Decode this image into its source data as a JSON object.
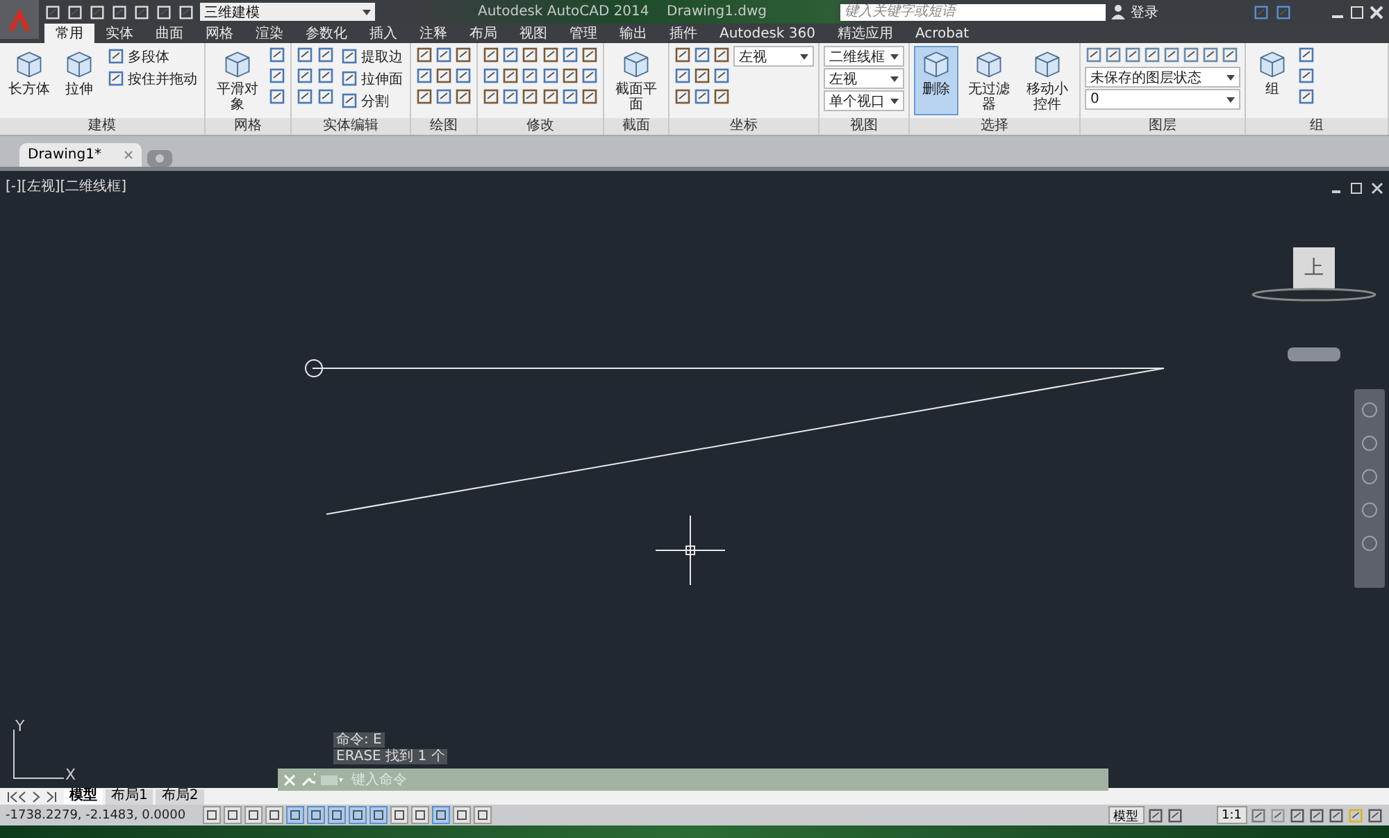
{
  "title_bar": {
    "workspace": "三维建模",
    "app_title": "Autodesk AutoCAD 2014",
    "file_name": "Drawing1.dwg",
    "search_placeholder": "键入关键字或短语",
    "login": "登录"
  },
  "ribbon_tabs": [
    {
      "label": "常用",
      "selected": true
    },
    {
      "label": "实体",
      "selected": false
    },
    {
      "label": "曲面",
      "selected": false
    },
    {
      "label": "网格",
      "selected": false
    },
    {
      "label": "渲染",
      "selected": false
    },
    {
      "label": "参数化",
      "selected": false
    },
    {
      "label": "插入",
      "selected": false
    },
    {
      "label": "注释",
      "selected": false
    },
    {
      "label": "布局",
      "selected": false
    },
    {
      "label": "视图",
      "selected": false
    },
    {
      "label": "管理",
      "selected": false
    },
    {
      "label": "输出",
      "selected": false
    },
    {
      "label": "插件",
      "selected": false
    },
    {
      "label": "Autodesk 360",
      "selected": false
    },
    {
      "label": "精选应用",
      "selected": false
    },
    {
      "label": "Acrobat",
      "selected": false
    }
  ],
  "ribbon_panels": [
    {
      "title": "建模",
      "items": [
        {
          "kind": "large",
          "label": "长方体",
          "selected": false
        },
        {
          "kind": "large",
          "label": "拉伸",
          "selected": false
        },
        {
          "kind": "stack",
          "labels": [
            "多段体",
            "按住并拖动"
          ]
        }
      ]
    },
    {
      "title": "网格",
      "items": [
        {
          "kind": "large",
          "label": "平滑对象",
          "selected": false
        },
        {
          "kind": "icon-column"
        }
      ]
    },
    {
      "title": "实体编辑",
      "items": [
        {
          "kind": "icon-column"
        },
        {
          "kind": "icon-column"
        },
        {
          "kind": "stack",
          "labels": [
            "提取边",
            "拉伸面",
            "分割"
          ]
        }
      ]
    },
    {
      "title": "绘图",
      "items": [
        {
          "kind": "icon-grid"
        }
      ]
    },
    {
      "title": "修改",
      "items": [
        {
          "kind": "icon-grid"
        },
        {
          "kind": "icon-grid"
        }
      ]
    },
    {
      "title": "截面",
      "items": [
        {
          "kind": "large",
          "label": "截面平面",
          "selected": false
        }
      ]
    },
    {
      "title": "坐标",
      "items": [
        {
          "kind": "icon-grid"
        },
        {
          "kind": "dropdowns",
          "values": [
            "左视"
          ]
        }
      ]
    },
    {
      "title": "视图",
      "items": [
        {
          "kind": "dropdowns",
          "values": [
            "二维线框",
            "左视",
            "单个视口"
          ]
        }
      ]
    },
    {
      "title": "选择",
      "items": [
        {
          "kind": "large",
          "label": "删除",
          "selected": true
        },
        {
          "kind": "large",
          "label": "无过滤器",
          "selected": false
        },
        {
          "kind": "large",
          "label": "移动小控件",
          "selected": false
        }
      ]
    },
    {
      "title": "图层",
      "items": [
        {
          "kind": "icon-row"
        },
        {
          "kind": "dropdowns",
          "values": [
            "未保存的图层状态",
            "0"
          ]
        }
      ]
    },
    {
      "title": "组",
      "items": [
        {
          "kind": "large",
          "label": "组",
          "selected": false
        },
        {
          "kind": "icon-column"
        }
      ]
    }
  ],
  "doc_tabs": [
    {
      "label": "Drawing1*",
      "selected": true
    }
  ],
  "viewport": {
    "label": "[-][左视][二维线框]",
    "viewcube_face": "上",
    "ucs_axes": [
      "Y",
      "X"
    ],
    "command_history": [
      "命令: E",
      "ERASE 找到 1 个"
    ],
    "command_placeholder": "键入命令"
  },
  "layout_tabs": [
    {
      "label": "模型",
      "selected": true
    },
    {
      "label": "布局1",
      "selected": false
    },
    {
      "label": "布局2",
      "selected": false
    }
  ],
  "status_bar": {
    "coordinates": "-1738.2279, -2.1483, 0.0000",
    "toggles": [
      {
        "on": false
      },
      {
        "on": false
      },
      {
        "on": false
      },
      {
        "on": false
      },
      {
        "on": true
      },
      {
        "on": true
      },
      {
        "on": true
      },
      {
        "on": true
      },
      {
        "on": true
      },
      {
        "on": false
      },
      {
        "on": false
      },
      {
        "on": true
      },
      {
        "on": false
      },
      {
        "on": false
      }
    ],
    "space": "模型",
    "scale": "1:1"
  }
}
